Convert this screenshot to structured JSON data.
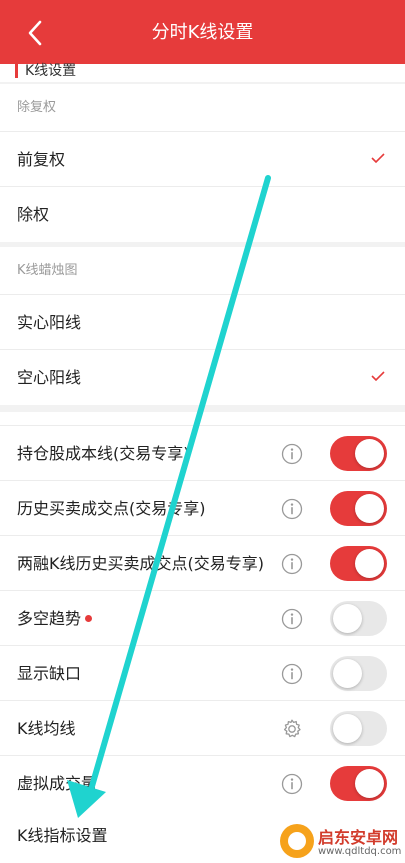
{
  "header": {
    "title": "分时K线设置"
  },
  "section": {
    "title": "K线设置"
  },
  "fuquan": {
    "title": "除复权",
    "options": [
      {
        "label": "前复权",
        "checked": true
      },
      {
        "label": "除权",
        "checked": false
      }
    ]
  },
  "candle": {
    "title": "K线蜡烛图",
    "options": [
      {
        "label": "实心阳线",
        "checked": false
      },
      {
        "label": "空心阳线",
        "checked": true
      }
    ]
  },
  "toggles": [
    {
      "label": "持仓股成本线(交易专享)",
      "icon": "info-icon",
      "on": true
    },
    {
      "label": "历史买卖成交点(交易专享)",
      "icon": "info-icon",
      "on": true
    },
    {
      "label": "两融K线历史买卖成交点(交易专享)",
      "icon": "info-icon",
      "on": true
    },
    {
      "label": "多空趋势",
      "icon": "info-icon",
      "on": false,
      "new_dot": true
    },
    {
      "label": "显示缺口",
      "icon": "info-icon",
      "on": false
    },
    {
      "label": "K线均线",
      "icon": "gear-icon",
      "on": false
    },
    {
      "label": "虚拟成交量",
      "icon": "info-icon",
      "on": true
    }
  ],
  "footer_item": {
    "label": "K线指标设置"
  },
  "watermark": {
    "title": "启东安卓网",
    "url": "www.qdltdq.com"
  },
  "colors": {
    "accent": "#e63b3b",
    "annotation_arrow": "#1fd3cf"
  }
}
